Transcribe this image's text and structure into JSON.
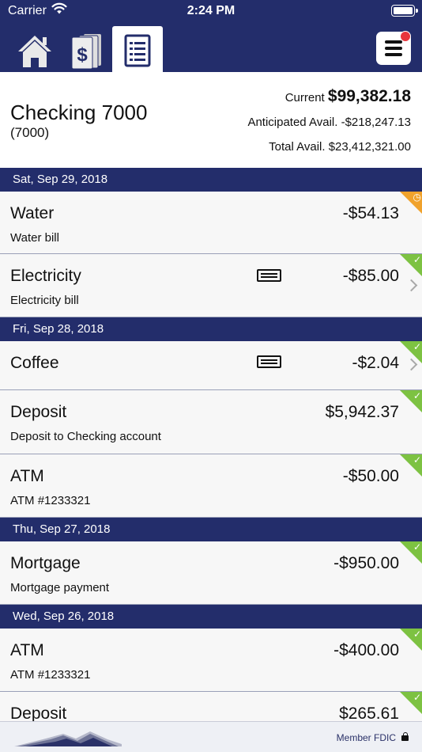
{
  "status_bar": {
    "carrier": "Carrier",
    "time": "2:24 PM"
  },
  "tabs": [
    {
      "icon": "home-icon",
      "active": false
    },
    {
      "icon": "money-icon",
      "active": false
    },
    {
      "icon": "register-icon",
      "active": true
    }
  ],
  "menu": {
    "icon": "hamburger-menu-icon",
    "notification": true
  },
  "account": {
    "name": "Checking 7000",
    "number": "(7000)",
    "current_label": "Current",
    "current_amount": "$99,382.18",
    "anticipated_label": "Anticipated Avail.",
    "anticipated_amount": "-$218,247.13",
    "total_label": "Total Avail.",
    "total_amount": "$23,412,321.00"
  },
  "dates": [
    "Sat, Sep 29, 2018",
    "Fri, Sep 28, 2018",
    "Thu, Sep 27, 2018",
    "Wed, Sep 26, 2018"
  ],
  "transactions": [
    {
      "name": "Water",
      "desc": "Water bill",
      "amount": "-$54.13",
      "status": "pending",
      "card": false
    },
    {
      "name": "Electricity",
      "desc": "Electricity bill",
      "amount": "-$85.00",
      "status": "cleared",
      "card": true
    },
    {
      "name": "Coffee",
      "desc": "",
      "amount": "-$2.04",
      "status": "cleared",
      "card": true
    },
    {
      "name": "Deposit",
      "desc": "Deposit to Checking account",
      "amount": "$5,942.37",
      "status": "cleared",
      "card": false
    },
    {
      "name": "ATM",
      "desc": "ATM #1233321",
      "amount": "-$50.00",
      "status": "cleared",
      "card": false
    },
    {
      "name": "Mortgage",
      "desc": "Mortgage payment",
      "amount": "-$950.00",
      "status": "cleared",
      "card": false
    },
    {
      "name": "ATM",
      "desc": "ATM #1233321",
      "amount": "-$400.00",
      "status": "cleared",
      "card": false
    },
    {
      "name": "Deposit",
      "desc": "",
      "amount": "$265.61",
      "status": "cleared",
      "card": false
    }
  ],
  "footer": {
    "fdic": "Member FDIC",
    "logo_icon": "mountain-logo-icon",
    "lock_icon": "lock-icon"
  },
  "colors": {
    "primary": "#232d6b",
    "cleared": "#7dc242",
    "pending": "#f0a22c",
    "notification": "#e8353d"
  }
}
